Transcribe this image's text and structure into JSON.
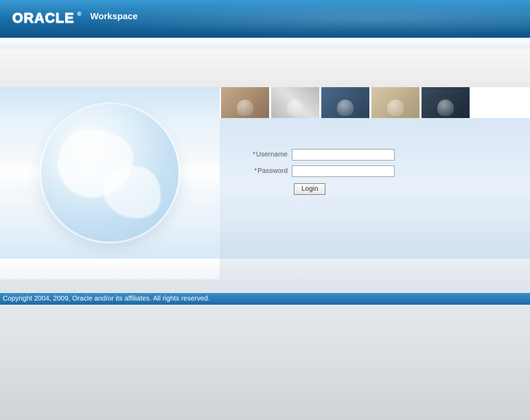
{
  "header": {
    "brand": "ORACLE",
    "registered": "®",
    "title": "Workspace"
  },
  "login": {
    "username_label": "Username",
    "password_label": "Password",
    "required_marker": "*",
    "username_value": "",
    "password_value": "",
    "button_label": "Login"
  },
  "footer": {
    "copyright": "Copyright 2004, 2009, Oracle and/or its affiliates. All rights reserved."
  }
}
